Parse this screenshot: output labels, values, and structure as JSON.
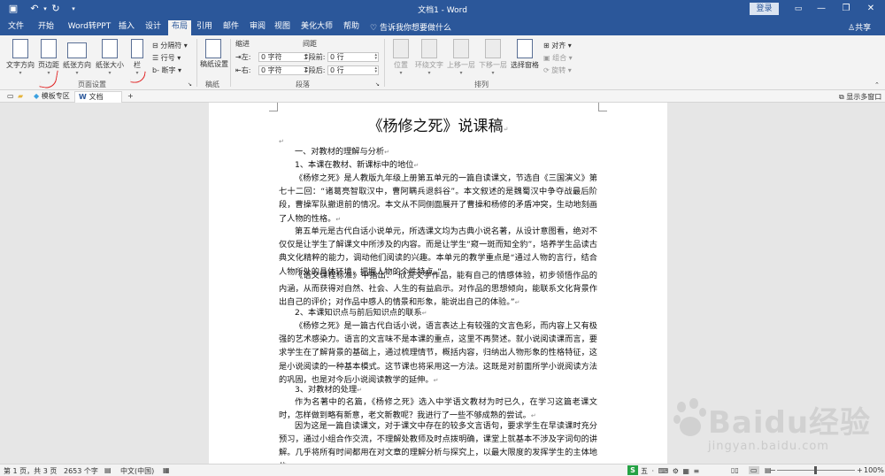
{
  "app": {
    "doc_title": "文档1 - Word",
    "login_label": "登录",
    "window_min": "—",
    "window_restore": "❐",
    "window_close": "✕"
  },
  "menu": {
    "tabs": [
      "文件",
      "开始",
      "Word转PPT",
      "插入",
      "设计",
      "布局",
      "引用",
      "邮件",
      "审阅",
      "视图",
      "美化大师",
      "帮助"
    ],
    "active_tab": "布局",
    "tell_me": "告诉我你想要做什么",
    "share": "共享"
  },
  "ribbon": {
    "page_setup": {
      "group_label": "页面设置",
      "text_direction": "文字方向",
      "margins": "页边距",
      "orientation": "纸张方向",
      "size": "纸张大小",
      "columns": "栏",
      "breaks": "分隔符",
      "line_numbers": "行号",
      "hyphenation": "断字"
    },
    "manuscript": {
      "group_label": "稿纸",
      "setup": "稿纸设置"
    },
    "paragraph": {
      "group_label": "段落",
      "indent_title": "缩进",
      "spacing_title": "间距",
      "indent_left_label": "左:",
      "indent_left_value": "0 字符",
      "indent_right_label": "右:",
      "indent_right_value": "0 字符",
      "spacing_before_label": "段前:",
      "spacing_before_value": "0 行",
      "spacing_after_label": "段后:",
      "spacing_after_value": "0 行"
    },
    "arrange": {
      "group_label": "排列",
      "position": "位置",
      "wrap_text": "环绕文字",
      "bring_forward": "上移一层",
      "send_backward": "下移一层",
      "selection_pane": "选择窗格",
      "align": "对齐",
      "group": "组合",
      "rotate": "旋转"
    }
  },
  "doc_tabs": {
    "template_tab": "模板专区",
    "active_doc": "文档1",
    "new_tab": "+",
    "multi_window": "显示多窗口"
  },
  "document": {
    "heading": "《杨修之死》说课稿",
    "paragraphs": [
      "一、对教材的理解与分析",
      "1、本课在教材、新课标中的地位",
      "《杨修之死》是人教版九年级上册第五单元的一篇自读课文，节选自《三国演义》第七十二回：“诸葛亮智取汉中，曹阿瞒兵退斜谷”。本文叙述的是魏蜀汉中争夺战最后阶段，曹操军队撤退前的情况。本文从不同侧面展开了曹操和杨修的矛盾冲突，生动地刻画了人物的性格。",
      "第五单元是古代白话小说单元，所选课文均为古典小说名著，从设计意图看，绝对不仅仅是让学生了解课文中所涉及的内容。而是让学生“窥一斑而知全豹”，培养学生品读古典文化精粹的能力，调动他们阅读的兴趣。本单元的教学重点是“通过人物的言行，结合人物所处的具体环境，把握人物的个性特点。”",
      "《语文课程标准》中指出：“欣赏文学作品，能有自己的情感体验，初步领悟作品的内涵，从而获得对自然、社会、人生的有益启示。对作品的思想倾向，能联系文化背景作出自己的评价；对作品中感人的情景和形象，能说出自己的体验。”",
      "2、本课知识点与前后知识点的联系",
      "《杨修之死》是一篇古代白话小说，语言表达上有较强的文言色彩，而内容上又有极强的艺术感染力。语言的文言味不是本课的重点，这里不再赘述。就小说阅读课而言，要求学生在了解背景的基础上，通过梳理情节，概括内容，归纳出人物形象的性格特征，这是小说阅读的一种基本模式。这节课也将采用这一方法。这既是对前面所学小说阅读方法的巩固，也是对今后小说阅读教学的延伸。",
      "3、对教材的处理",
      "作为名著中的名篇，《杨修之死》选入中学语文教材为时已久，在学习这篇老课文时，怎样做到略有新意，老文新教呢？我进行了一些不够成熟的尝试。",
      "因为这是一篇自读课文，对于课文中存在的较多文言语句，要求学生在早读课时充分预习，通过小组合作交流，不理解处教师及时点拨明确，课堂上就基本不涉及字词句的讲解。几乎将所有时间都用在对文章的理解分析与探究上，以最大限度的发挥学生的主体地位。"
    ]
  },
  "statusbar": {
    "page_info": "第 1 页，共 3 页",
    "word_count": "2653 个字",
    "language": "中文(中国)",
    "ime_label": "S",
    "ime_items": "五 · ⌨ ⚙ ▦ ≡",
    "zoom": "100%",
    "zoom_minus": "−",
    "zoom_plus": "+"
  },
  "watermark": {
    "brand": "Baidu经验",
    "url": "jingyan.baidu.com"
  },
  "colors": {
    "ribbon_blue": "#2b579a",
    "annotation_red": "#e02020",
    "ime_green": "#25a244"
  }
}
